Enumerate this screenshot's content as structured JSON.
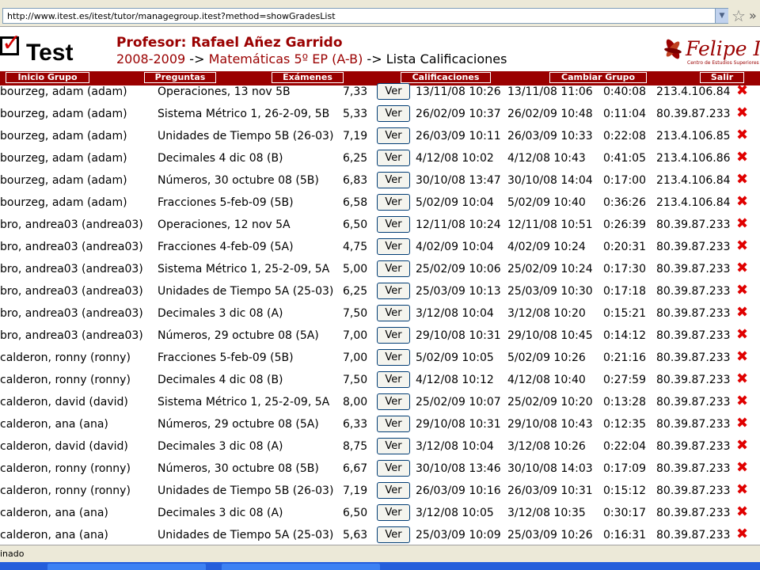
{
  "browser": {
    "url": "http://www.itest.es/itest/tutor/managegroup.itest?method=showGradesList",
    "status": "inado"
  },
  "header": {
    "logo": "Test",
    "professor": "Profesor: Rafael Añez Garrido",
    "crumb_year": "2008-2009",
    "crumb_sep1": " -> ",
    "crumb_subject": "Matemáticas 5º EP (A-B)",
    "crumb_sep2": " -> ",
    "crumb_page": "Lista Calificaciones",
    "school_logo": "Felipe II",
    "school_sub": "Centro de Estudios Superiores"
  },
  "nav": {
    "inicio": "Inicio Grupo",
    "preguntas": "Preguntas",
    "examenes": "Exámenes",
    "calificaciones": "Calificaciones",
    "cambiar": "Cambiar Grupo",
    "salir": "Salir"
  },
  "ver_label": "Ver",
  "delete_icon": "close-x-icon",
  "colors": {
    "brand": "#9a0000",
    "delete": "#e00000"
  },
  "rows": [
    {
      "name": "bourzeg, adam (adam)",
      "exam": "Operaciones, 13 nov 5B",
      "grade": "7,33",
      "start": "13/11/08 10:26",
      "end": "13/11/08 11:06",
      "duration": "0:40:08",
      "ip": "213.4.106.84"
    },
    {
      "name": "bourzeg, adam (adam)",
      "exam": "Sistema Métrico 1, 26-2-09, 5B",
      "grade": "5,33",
      "start": "26/02/09 10:37",
      "end": "26/02/09 10:48",
      "duration": "0:11:04",
      "ip": "80.39.87.233"
    },
    {
      "name": "bourzeg, adam (adam)",
      "exam": "Unidades de Tiempo 5B (26-03)",
      "grade": "7,19",
      "start": "26/03/09 10:11",
      "end": "26/03/09 10:33",
      "duration": "0:22:08",
      "ip": "213.4.106.85"
    },
    {
      "name": "bourzeg, adam (adam)",
      "exam": "Decimales 4 dic 08 (B)",
      "grade": "6,25",
      "start": "4/12/08 10:02",
      "end": "4/12/08 10:43",
      "duration": "0:41:05",
      "ip": "213.4.106.86"
    },
    {
      "name": "bourzeg, adam (adam)",
      "exam": "Números, 30 octubre 08 (5B)",
      "grade": "6,83",
      "start": "30/10/08 13:47",
      "end": "30/10/08 14:04",
      "duration": "0:17:00",
      "ip": "213.4.106.84"
    },
    {
      "name": "bourzeg, adam (adam)",
      "exam": "Fracciones 5-feb-09 (5B)",
      "grade": "6,58",
      "start": "5/02/09 10:04",
      "end": "5/02/09 10:40",
      "duration": "0:36:26",
      "ip": "213.4.106.84"
    },
    {
      "name": "bro, andrea03 (andrea03)",
      "exam": "Operaciones, 12 nov 5A",
      "grade": "6,50",
      "start": "12/11/08 10:24",
      "end": "12/11/08 10:51",
      "duration": "0:26:39",
      "ip": "80.39.87.233"
    },
    {
      "name": "bro, andrea03 (andrea03)",
      "exam": "Fracciones 4-feb-09 (5A)",
      "grade": "4,75",
      "start": "4/02/09 10:04",
      "end": "4/02/09 10:24",
      "duration": "0:20:31",
      "ip": "80.39.87.233"
    },
    {
      "name": "bro, andrea03 (andrea03)",
      "exam": "Sistema Métrico 1, 25-2-09, 5A",
      "grade": "5,00",
      "start": "25/02/09 10:06",
      "end": "25/02/09 10:24",
      "duration": "0:17:30",
      "ip": "80.39.87.233"
    },
    {
      "name": "bro, andrea03 (andrea03)",
      "exam": "Unidades de Tiempo 5A (25-03)",
      "grade": "6,25",
      "start": "25/03/09 10:13",
      "end": "25/03/09 10:30",
      "duration": "0:17:18",
      "ip": "80.39.87.233"
    },
    {
      "name": "bro, andrea03 (andrea03)",
      "exam": "Decimales 3 dic 08 (A)",
      "grade": "7,50",
      "start": "3/12/08 10:04",
      "end": "3/12/08 10:20",
      "duration": "0:15:21",
      "ip": "80.39.87.233"
    },
    {
      "name": "bro, andrea03 (andrea03)",
      "exam": "Números, 29 octubre 08 (5A)",
      "grade": "7,00",
      "start": "29/10/08 10:31",
      "end": "29/10/08 10:45",
      "duration": "0:14:12",
      "ip": "80.39.87.233"
    },
    {
      "name": "calderon, ronny (ronny)",
      "exam": "Fracciones 5-feb-09 (5B)",
      "grade": "7,00",
      "start": "5/02/09 10:05",
      "end": "5/02/09 10:26",
      "duration": "0:21:16",
      "ip": "80.39.87.233"
    },
    {
      "name": "calderon, ronny (ronny)",
      "exam": "Decimales 4 dic 08 (B)",
      "grade": "7,50",
      "start": "4/12/08 10:12",
      "end": "4/12/08 10:40",
      "duration": "0:27:59",
      "ip": "80.39.87.233"
    },
    {
      "name": "calderon, david (david)",
      "exam": "Sistema Métrico 1, 25-2-09, 5A",
      "grade": "8,00",
      "start": "25/02/09 10:07",
      "end": "25/02/09 10:20",
      "duration": "0:13:28",
      "ip": "80.39.87.233"
    },
    {
      "name": "calderon, ana (ana)",
      "exam": "Números, 29 octubre 08 (5A)",
      "grade": "6,33",
      "start": "29/10/08 10:31",
      "end": "29/10/08 10:43",
      "duration": "0:12:35",
      "ip": "80.39.87.233"
    },
    {
      "name": "calderon, david (david)",
      "exam": "Decimales 3 dic 08 (A)",
      "grade": "8,75",
      "start": "3/12/08 10:04",
      "end": "3/12/08 10:26",
      "duration": "0:22:04",
      "ip": "80.39.87.233"
    },
    {
      "name": "calderon, ronny (ronny)",
      "exam": "Números, 30 octubre 08 (5B)",
      "grade": "6,67",
      "start": "30/10/08 13:46",
      "end": "30/10/08 14:03",
      "duration": "0:17:09",
      "ip": "80.39.87.233"
    },
    {
      "name": "calderon, ronny (ronny)",
      "exam": "Unidades de Tiempo 5B (26-03)",
      "grade": "7,19",
      "start": "26/03/09 10:16",
      "end": "26/03/09 10:31",
      "duration": "0:15:12",
      "ip": "80.39.87.233"
    },
    {
      "name": "calderon, ana (ana)",
      "exam": "Decimales 3 dic 08 (A)",
      "grade": "6,50",
      "start": "3/12/08 10:05",
      "end": "3/12/08 10:35",
      "duration": "0:30:17",
      "ip": "80.39.87.233"
    },
    {
      "name": "calderon, ana (ana)",
      "exam": "Unidades de Tiempo 5A (25-03)",
      "grade": "5,63",
      "start": "25/03/09 10:09",
      "end": "25/03/09 10:26",
      "duration": "0:16:31",
      "ip": "80.39.87.233"
    }
  ]
}
